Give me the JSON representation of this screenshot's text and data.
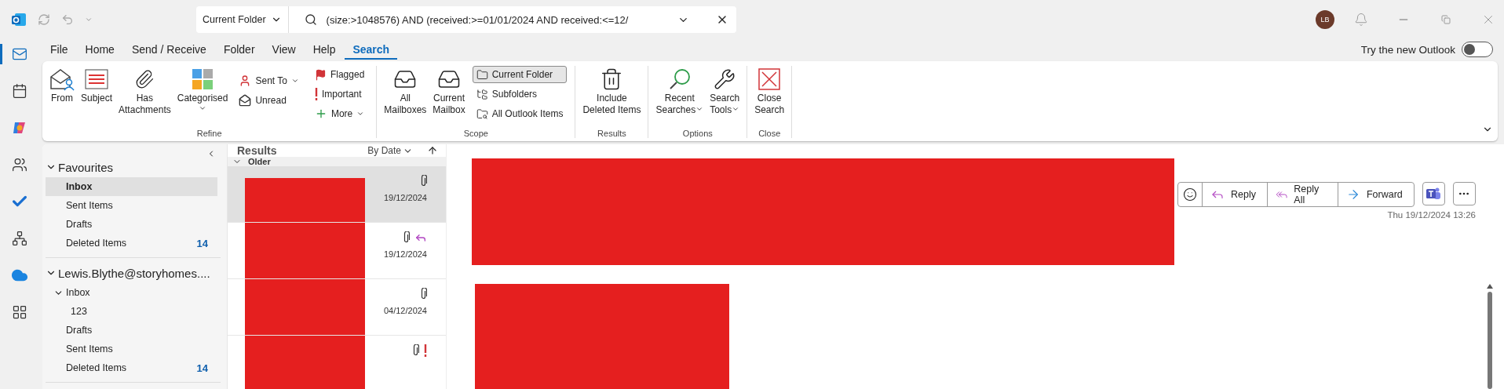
{
  "title_bar": {
    "scope": "Current Folder",
    "query": "(size:>1048576) AND (received:>=01/01/2024 AND received:<=12/",
    "avatar": "LB"
  },
  "rail": [
    {
      "kind": "mail",
      "selected": true
    },
    {
      "kind": "calendar",
      "selected": false
    },
    {
      "kind": "copilot",
      "selected": false
    },
    {
      "kind": "people",
      "selected": false
    },
    {
      "kind": "todo",
      "selected": false
    },
    {
      "kind": "org",
      "selected": false
    },
    {
      "kind": "cloud",
      "selected": false
    },
    {
      "kind": "apps",
      "selected": false
    }
  ],
  "menu_tabs": [
    {
      "label": "File",
      "selected": false
    },
    {
      "label": "Home",
      "selected": false
    },
    {
      "label": "Send / Receive",
      "selected": false
    },
    {
      "label": "Folder",
      "selected": false
    },
    {
      "label": "View",
      "selected": false
    },
    {
      "label": "Help",
      "selected": false
    },
    {
      "label": "Search",
      "selected": true
    }
  ],
  "new_outlook": {
    "label": "Try the new Outlook",
    "on": false
  },
  "ribbon": {
    "groups": [
      {
        "label": "Refine",
        "items": [
          {
            "kind": "large",
            "label": "From"
          },
          {
            "kind": "large",
            "label": "Subject"
          },
          {
            "kind": "large",
            "label": "Has\nAttachments"
          },
          {
            "kind": "large",
            "label": "Categorised",
            "dropdown": true
          },
          {
            "kind": "stack",
            "items": [
              {
                "label": "Sent To",
                "dropdown": true
              },
              {
                "label": "Unread"
              }
            ]
          },
          {
            "kind": "stack",
            "items": [
              {
                "label": "Flagged"
              },
              {
                "label": "Important"
              },
              {
                "label": "More",
                "dropdown": true
              }
            ]
          }
        ]
      },
      {
        "label": "Scope",
        "items": [
          {
            "kind": "large",
            "label": "All\nMailboxes",
            "selected": false
          },
          {
            "kind": "large",
            "label": "Current\nMailbox",
            "selected": false
          },
          {
            "kind": "stack",
            "items": [
              {
                "label": "Current Folder",
                "selected": true
              },
              {
                "label": "Subfolders",
                "selected": false
              },
              {
                "label": "All Outlook Items",
                "selected": false
              }
            ]
          }
        ]
      },
      {
        "label": "Results",
        "items": [
          {
            "kind": "large",
            "label": "Include\nDeleted Items"
          }
        ]
      },
      {
        "label": "Options",
        "items": [
          {
            "kind": "large",
            "label": "Recent\nSearches",
            "dropdown": true
          },
          {
            "kind": "large",
            "label": "Search\nTools",
            "dropdown": true
          }
        ]
      },
      {
        "label": "Close",
        "items": [
          {
            "kind": "large",
            "label": "Close\nSearch"
          }
        ]
      }
    ]
  },
  "folders": [
    {
      "label": "Favourites",
      "expanded": true,
      "children": [
        {
          "label": "Inbox",
          "selected": true
        },
        {
          "label": "Sent Items",
          "selected": false
        },
        {
          "label": "Drafts",
          "selected": false
        },
        {
          "label": "Deleted Items",
          "count": "14",
          "selected": false
        }
      ]
    },
    {
      "label": "Lewis.Blythe@storyhomes....",
      "expanded": true,
      "children": [
        {
          "label": "Inbox",
          "selected": false,
          "expanded": true,
          "children": [
            {
              "label": "123",
              "selected": false
            }
          ]
        },
        {
          "label": "Drafts",
          "selected": false
        },
        {
          "label": "Sent Items",
          "selected": false
        },
        {
          "label": "Deleted Items",
          "count": "14",
          "selected": false
        }
      ]
    }
  ],
  "message_list": {
    "title": "Results",
    "sort": "By Date",
    "group": {
      "label": "Older",
      "expanded": true
    },
    "messages": [
      {
        "date": "19/12/2024",
        "attachment": true,
        "replied": false,
        "important": false,
        "redacted": true,
        "selected": true
      },
      {
        "date": "19/12/2024",
        "attachment": true,
        "replied": true,
        "important": false,
        "redacted": true,
        "selected": false
      },
      {
        "date": "04/12/2024",
        "attachment": true,
        "replied": false,
        "important": false,
        "redacted": true,
        "selected": false
      },
      {
        "attachment": true,
        "replied": false,
        "important": true,
        "redacted": true,
        "selected": false
      }
    ]
  },
  "reading_pane": {
    "header_redacted": true,
    "body_redacted": true,
    "actions": [
      {
        "kind": "emoji"
      },
      {
        "kind": "reply",
        "label": "Reply"
      },
      {
        "kind": "replyall",
        "label": "Reply All"
      },
      {
        "kind": "forward",
        "label": "Forward"
      }
    ],
    "received": "Thu 19/12/2024 13:26"
  }
}
